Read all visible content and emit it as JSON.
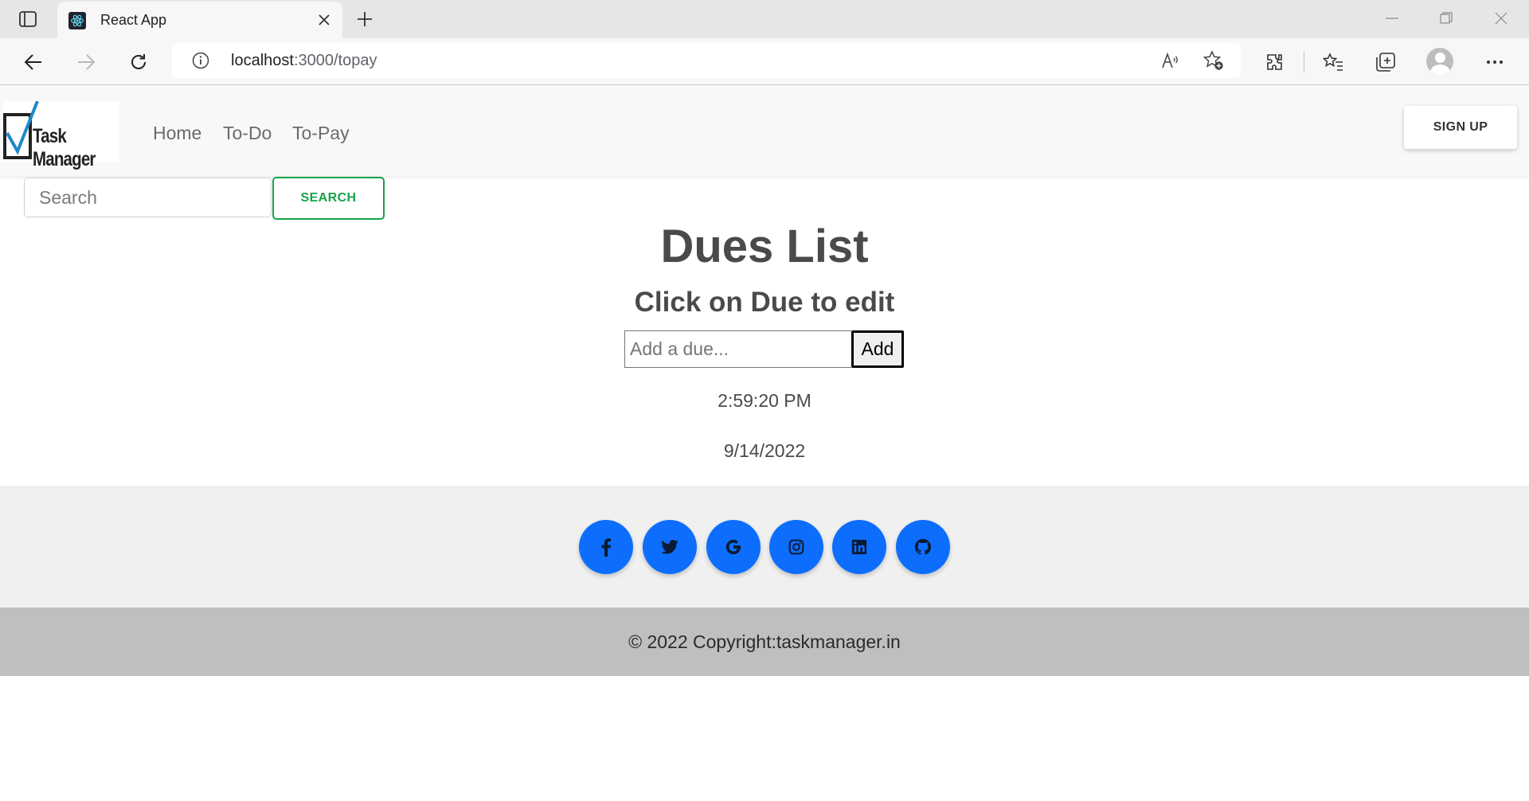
{
  "browser": {
    "tab_title": "React App",
    "url_host": "localhost",
    "url_path": ":3000/topay",
    "icons": [
      "tab-actions-icon",
      "react-favicon-icon",
      "close-icon",
      "plus-icon",
      "minimize-icon",
      "restore-icon",
      "close-window-icon",
      "back-icon",
      "forward-icon",
      "refresh-icon",
      "info-icon",
      "read-aloud-icon",
      "add-favorite-icon",
      "extensions-icon",
      "favorites-icon",
      "collections-icon",
      "profile-icon",
      "more-icon"
    ]
  },
  "navbar": {
    "logo_text": "Task Manager",
    "links": [
      "Home",
      "To-Do",
      "To-Pay"
    ],
    "signup_label": "SIGN UP"
  },
  "search": {
    "placeholder": "Search",
    "button_label": "SEARCH"
  },
  "main": {
    "title": "Dues List",
    "subtitle": "Click on Due to edit",
    "input_placeholder": "Add a due...",
    "add_label": "Add",
    "time": "2:59:20 PM",
    "date": "9/14/2022"
  },
  "footer": {
    "social": [
      "facebook-icon",
      "twitter-icon",
      "google-icon",
      "instagram-icon",
      "linkedin-icon",
      "github-icon"
    ],
    "accent_color": "#0d6efd",
    "copyright": "© 2022 Copyright:taskmanager.in"
  },
  "colors": {
    "search_button": "#16a34a",
    "navbar_bg": "#f8f8f8",
    "footer_bg": "#f0f0f0",
    "copyright_bg": "#bfbfbf"
  }
}
